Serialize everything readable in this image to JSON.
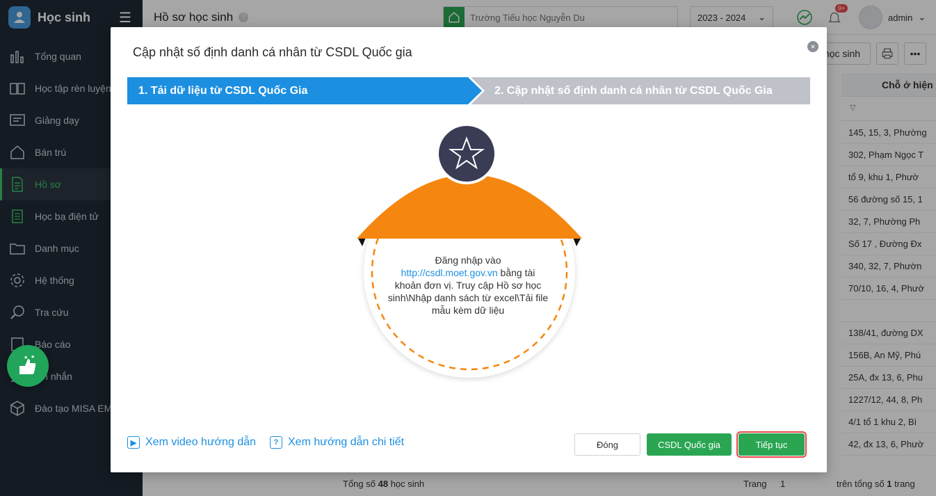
{
  "app": {
    "title": "Học sinh"
  },
  "sidebar": {
    "items": [
      {
        "label": "Tổng quan",
        "icon": "chart-bars-icon"
      },
      {
        "label": "Học tập rèn luyện",
        "icon": "book-icon"
      },
      {
        "label": "Giảng dạy",
        "icon": "board-icon"
      },
      {
        "label": "Bán trú",
        "icon": "house-icon"
      },
      {
        "label": "Hồ sơ",
        "icon": "document-icon",
        "active": true
      },
      {
        "label": "Học bạ điện tử",
        "icon": "record-icon"
      },
      {
        "label": "Danh mục",
        "icon": "folder-icon"
      },
      {
        "label": "Hệ thống",
        "icon": "gear-icon"
      },
      {
        "label": "Tra cứu",
        "icon": "search-icon"
      },
      {
        "label": "Báo cáo",
        "icon": "report-icon"
      },
      {
        "label": "Tin nhắn",
        "icon": "bell-icon"
      },
      {
        "label": "Đào tạo MISA EMIS",
        "icon": "cube-icon"
      }
    ]
  },
  "header": {
    "page_title": "Hồ sơ học sinh",
    "help": "?",
    "search_placeholder": "Trường Tiểu học Nguyễn Du",
    "school_year": "2023 - 2024",
    "notif_badge": "9+",
    "username": "admin"
  },
  "background": {
    "toolbar_button": "học sinh",
    "column_header": "Chỗ ở hiện",
    "rows": [
      "145, 15, 3, Phường",
      "302, Phạm Ngọc T",
      "tổ 9, khu 1, Phườ",
      "56 đường số 15, 1",
      "32, 7, Phường Ph",
      "Số 17 , Đường Đx",
      "340, 32, 7, Phườn",
      "70/10, 16, 4, Phườ",
      "",
      "138/41, đường DX",
      "156B, An Mỹ, Phú",
      "25A, đx 13, 6, Phu",
      "1227/12, 44, 8, Ph",
      "4/1 tổ 1 khu 2, Bì",
      "42, đx 13, 6, Phườ"
    ],
    "footer_total_prefix": "Tổng số",
    "footer_total_count": "48",
    "footer_total_suffix": "học sinh",
    "footer_page_label": "Trang",
    "footer_page_value": "1",
    "footer_pages_prefix": "trên tổng số",
    "footer_pages_count": "1",
    "footer_pages_suffix": "trang"
  },
  "modal": {
    "title": "Cập nhật số định danh cá nhân từ CSDL Quốc gia",
    "close_icon": "×",
    "steps": [
      {
        "label": "1. Tải dữ liệu từ CSDL Quốc Gia",
        "active": true
      },
      {
        "label": "2. Cập nhật số định danh cá nhân từ CSDL Quốc Gia",
        "active": false
      }
    ],
    "info_prefix": "Đăng nhập vào ",
    "info_link": "http://csdl.moet.gov.vn",
    "info_suffix": " bằng tài khoản đơn vị. Truy cập Hồ sơ học sinh\\Nhập danh sách từ excel\\Tải file mẫu kèm dữ liệu",
    "help_video": "Xem video hướng dẫn",
    "help_detail": "Xem hướng dẫn chi tiết",
    "buttons": {
      "close": "Đóng",
      "csdl": "CSDL Quốc gia",
      "next": "Tiếp tục"
    }
  },
  "colors": {
    "accent_blue": "#1d8fe1",
    "green": "#2aa653",
    "orange": "#f5860f",
    "sidebar": "#1f2a36",
    "highlight_red": "#e54848"
  }
}
